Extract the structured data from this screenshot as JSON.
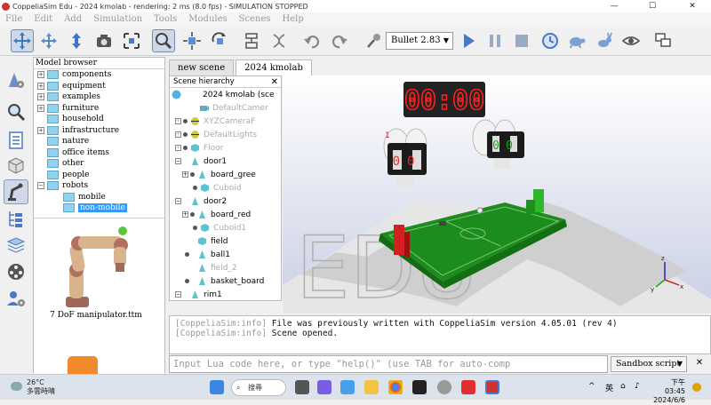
{
  "titlebar": {
    "title": "CoppeliaSim Edu - 2024 kmolab - rendering: 2 ms (8.0 fps) - SIMULATION STOPPED",
    "minimize": "—",
    "maximize": "☐",
    "close": "✕"
  },
  "menu": [
    "File",
    "Edit",
    "Add",
    "Simulation",
    "Tools",
    "Modules",
    "Scenes",
    "Help"
  ],
  "toolbar": {
    "engine": "Bullet 2.83"
  },
  "model_browser": {
    "header": "Model browser",
    "items": [
      {
        "label": "components",
        "expand": "+"
      },
      {
        "label": "equipment",
        "expand": "+"
      },
      {
        "label": "examples",
        "expand": "+"
      },
      {
        "label": "furniture",
        "expand": "+"
      },
      {
        "label": "household",
        "expand": ""
      },
      {
        "label": "infrastructure",
        "expand": "+"
      },
      {
        "label": "nature",
        "expand": ""
      },
      {
        "label": "office items",
        "expand": ""
      },
      {
        "label": "other",
        "expand": ""
      },
      {
        "label": "people",
        "expand": ""
      },
      {
        "label": "robots",
        "expand": "−"
      }
    ],
    "children": [
      {
        "label": "mobile"
      },
      {
        "label": "non-mobile"
      }
    ],
    "preview_caption": "7 DoF manipulator.ttm"
  },
  "tabs": [
    "new scene",
    "2024 kmolab"
  ],
  "scene_hierarchy": {
    "header": "Scene hierarchy",
    "close": "✕",
    "root": "2024 kmolab (sce",
    "rows": [
      {
        "label": "DefaultCamer",
        "dim": true
      },
      {
        "label": "XYZCameraF",
        "dim": true
      },
      {
        "label": "DefaultLights",
        "dim": true
      },
      {
        "label": "Floor",
        "dim": true
      },
      {
        "label": "door1",
        "dim": false
      },
      {
        "label": "board_gree",
        "dim": false
      },
      {
        "label": "Cuboid",
        "dim": true
      },
      {
        "label": "door2",
        "dim": false
      },
      {
        "label": "board_red",
        "dim": false
      },
      {
        "label": "Cuboid1",
        "dim": true
      },
      {
        "label": "field",
        "dim": false
      },
      {
        "label": "ball1",
        "dim": false
      },
      {
        "label": "field_2",
        "dim": true
      },
      {
        "label": "basket_board",
        "dim": false
      },
      {
        "label": "rim1",
        "dim": false
      }
    ]
  },
  "viewport": {
    "timer": "00:00",
    "watermark": "EDU",
    "score_left": "00",
    "score_right": "00"
  },
  "console": [
    {
      "tag": "[CoppeliaSim:info]",
      "text": "File was previously written with CoppeliaSim version 4.05.01 (rev 4)"
    },
    {
      "tag": "[CoppeliaSim:info]",
      "text": "Scene opened."
    }
  ],
  "lua": {
    "placeholder": "Input Lua code here, or type \"help()\" (use TAB for auto-comp",
    "sandbox": "Sandbox script",
    "close": "✕"
  },
  "taskbar": {
    "temp": "26°C",
    "weather": "多雲時晴",
    "search": "搜尋",
    "lang": "英",
    "time": "下午 03:45",
    "date": "2024/6/6"
  }
}
